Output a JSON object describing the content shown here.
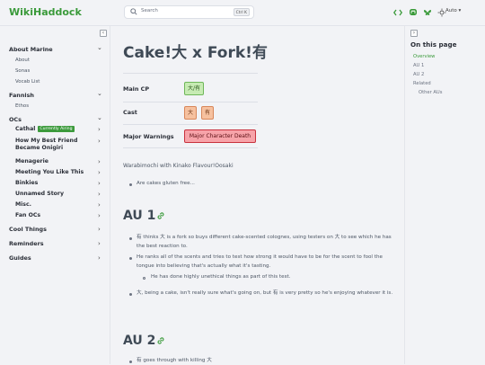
{
  "header": {
    "logo": "WikiHaddock",
    "search_placeholder": "Search",
    "search_shortcut": "Ctrl K",
    "theme_label": "Auto",
    "icons": [
      "code-icon",
      "mastodon-icon",
      "bluesky-icon",
      "theme-icon"
    ],
    "colors": {
      "accent": "#3a9a3a"
    }
  },
  "sidebar": {
    "sections": [
      {
        "label": "About Marine",
        "children": [
          "About",
          "Sonas",
          "Vocab List"
        ]
      },
      {
        "label": "Fannish",
        "children": [
          "Ethos"
        ]
      },
      {
        "label": "OCs"
      },
      {
        "label": "Cool Things"
      },
      {
        "label": "Reminders"
      },
      {
        "label": "Guides"
      }
    ],
    "ocs": [
      {
        "label": "Cathal",
        "badge": "Currently Airing"
      },
      {
        "label": "How My Best Friend Became Onigiri"
      },
      {
        "label": "Menagerie"
      },
      {
        "label": "Meeting You Like This"
      },
      {
        "label": "Binkies"
      },
      {
        "label": "Unnamed Story"
      },
      {
        "label": "Misc."
      },
      {
        "label": "Fan OCs"
      }
    ]
  },
  "page": {
    "title": "Cake!大 x Fork!有",
    "infobox": {
      "main_cp_label": "Main CP",
      "main_cp_tag": "大/有",
      "cast_label": "Cast",
      "cast_tags": [
        "大",
        "有"
      ],
      "warnings_label": "Major Warnings",
      "warnings_tag": "Major Character Death"
    },
    "intro": "Warabimochi with Kinako Flavour!Oosaki",
    "intro_bullet": "Are cakes gluten free...",
    "au1": {
      "heading": "AU 1",
      "bullets": [
        "有 thinks 大 is a fork so buys different cake-scented colognes, using testers on 大 to see which he has the best reaction to.",
        "He ranks all of the scents and tries to test how strong it would have to be for the scent to fool the tongue into believing that's actually what it's tasting.",
        "He has done highly unethical things as part of this test.",
        "大, being a cake, isn't really sure what's going on, but 有 is very pretty so he's enjoying whatever it is."
      ]
    },
    "au2": {
      "heading": "AU 2",
      "bullets": [
        "有 goes through with killing 大"
      ]
    }
  },
  "toc": {
    "title": "On this page",
    "items": [
      "Overview",
      "AU 1",
      "AU 2",
      "Related",
      "Other AUs"
    ]
  }
}
